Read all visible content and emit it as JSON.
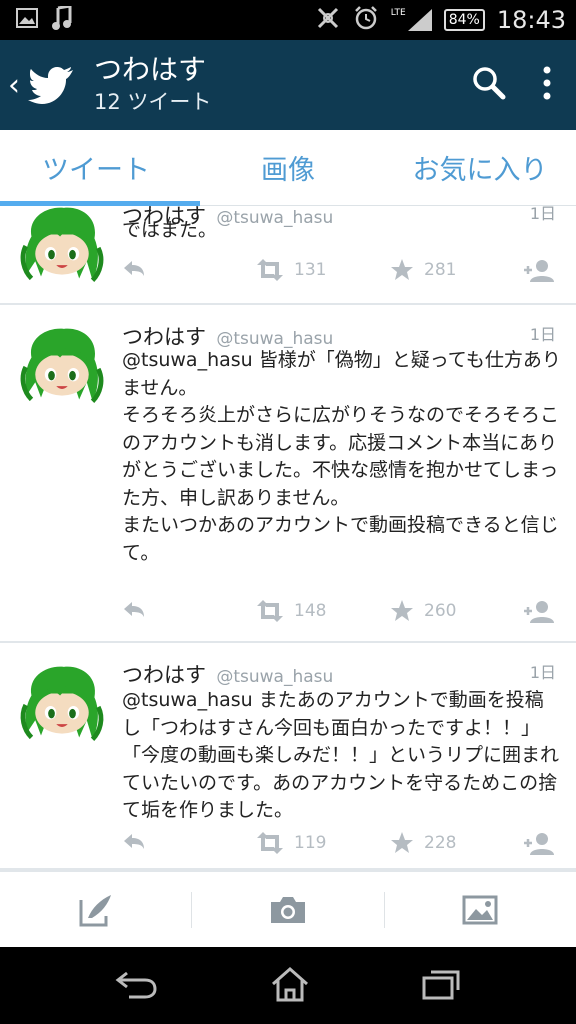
{
  "status_bar": {
    "network_label": "LTE",
    "battery": "84%",
    "time": "18:43"
  },
  "app_bar": {
    "title": "つわはす",
    "subtitle": "12 ツイート",
    "bg_color": "#0f3a52"
  },
  "tabs": [
    {
      "label": "ツイート",
      "selected": true
    },
    {
      "label": "画像",
      "selected": false
    },
    {
      "label": "お気に入り",
      "selected": false
    }
  ],
  "tweets": [
    {
      "name": "つわはす",
      "handle": "@tsuwa_hasu",
      "age": "1日",
      "text": "ではまた。",
      "retweets": "131",
      "favorites": "281"
    },
    {
      "name": "つわはす",
      "handle": "@tsuwa_hasu",
      "age": "1日",
      "text": "@tsuwa_hasu 皆様が「偽物」と疑っても仕方ありません。\nそろそろ炎上がさらに広がりそうなのでそろそろこのアカウントも消します。応援コメント本当にありがとうございました。不快な感情を抱かせてしまった方、申し訳ありません。\nまたいつかあのアカウントで動画投稿できると信じて。",
      "retweets": "148",
      "favorites": "260"
    },
    {
      "name": "つわはす",
      "handle": "@tsuwa_hasu",
      "age": "1日",
      "text": "@tsuwa_hasu またあのアカウントで動画を投稿し「つわはすさん今回も面白かったですよ！！」「今度の動画も楽しみだ！！」というリプに囲まれていたいのです。あのアカウントを守るためこの捨て垢を作りました。",
      "retweets": "119",
      "favorites": "228"
    }
  ]
}
